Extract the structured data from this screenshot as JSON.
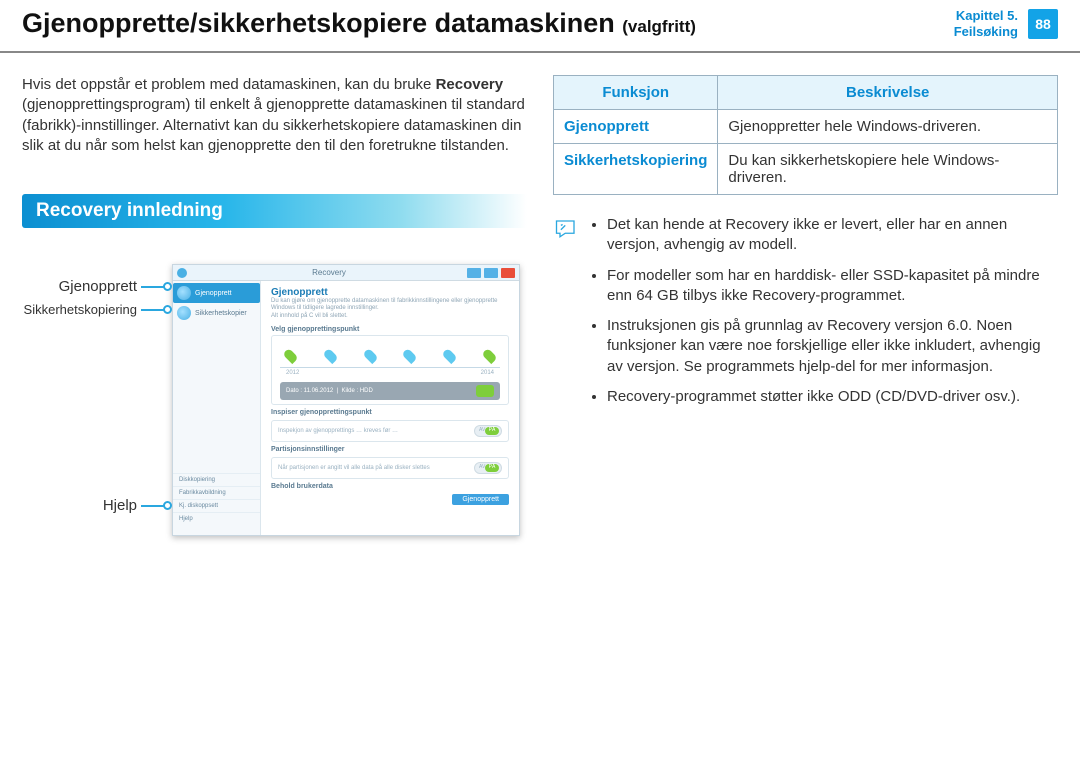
{
  "header": {
    "title_main": "Gjenopprette/sikkerhetskopiere datamaskinen",
    "title_suffix": "(valgfritt)",
    "chapter_line1": "Kapittel 5.",
    "chapter_line2": "Feilsøking",
    "page_number": "88"
  },
  "intro": {
    "t1": "Hvis det oppstår et problem med datamaskinen, kan du bruke ",
    "bold": "Recovery",
    "t2": " (gjenopprettingsprogram) til enkelt å gjenopprette datamaskinen til standard (fabrikk)-innstillinger. Alternativt kan du sikkerhetskopiere datamaskinen din slik at du når som helst kan gjenopprette den til den foretrukne tilstanden."
  },
  "section_heading": "Recovery innledning",
  "callouts": {
    "c1": "Gjenopprett",
    "c2": "Sikkerhetskopiering",
    "c3": "Hjelp"
  },
  "screenshot": {
    "window_title": "Recovery",
    "side_items": [
      "Gjenopprett",
      "Sikkerhetskopier"
    ],
    "bottom_items": [
      "Diskkopiering",
      "Fabrikkavbildning",
      "Kj. diskoppsett",
      "Hjelp"
    ],
    "main_heading": "Gjenopprett",
    "main_sub": "Du kan gjøre om gjenopprette datamaskinen til fabrikkinnstillingene eller gjenopprette Windows til tidligere lagrede innstillinger.",
    "main_sub2": "Alt innhold på C vil bli slettet.",
    "sec1": "Velg gjenopprettingspunkt",
    "tl_labels": [
      "2012",
      "2014"
    ],
    "info_date": "Dato : 11.06.2012",
    "info_source": "Kilde : HDD",
    "sec2": "Inspiser gjenopprettingspunkt",
    "row2_text": "Inspekjon av gjenopprettings … kreves før …",
    "sec3": "Partisjonsinnstillinger",
    "row3_text": "Når partisjonen er angitt vil alle data på alle disker slettes",
    "sec4": "Behold brukerdata",
    "toggle_off": "AV",
    "toggle_on": "PÅ",
    "primary_button": "Gjenopprett"
  },
  "table": {
    "h1": "Funksjon",
    "h2": "Beskrivelse",
    "rows": [
      {
        "func": "Gjenopprett",
        "desc": "Gjenoppretter hele Windows-driveren."
      },
      {
        "func": "Sikkerhetskopiering",
        "desc": "Du kan sikkerhetskopiere hele Windows-driveren."
      }
    ]
  },
  "notes": [
    "Det kan hende at Recovery ikke er levert, eller har en annen versjon, avhengig av modell.",
    "For modeller som har en harddisk- eller SSD-kapasitet på mindre enn 64 GB tilbys ikke Recovery-programmet.",
    "Instruksjonen gis på grunnlag av Recovery versjon 6.0. Noen funksjoner kan være noe forskjellige eller ikke inkludert, avhengig av versjon. Se programmets hjelp-del for mer informasjon.",
    "Recovery-programmet støtter ikke ODD (CD/DVD-driver osv.)."
  ]
}
